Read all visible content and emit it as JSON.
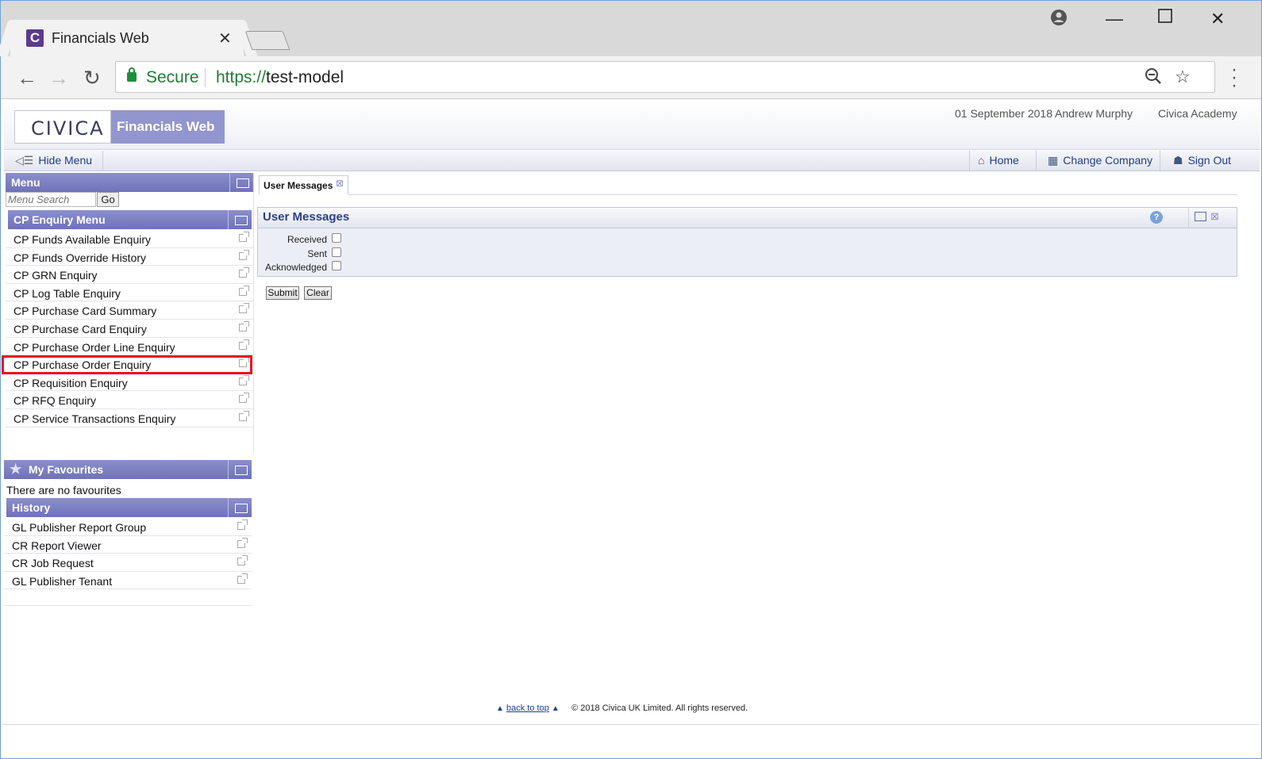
{
  "browser": {
    "tab_title": "Financials Web",
    "tab_favicon": "C",
    "secure_label": "Secure",
    "url_scheme": "https://",
    "url_host": "test-model"
  },
  "header": {
    "logo_text": "CIVICA",
    "product_name": "Financials Web",
    "date": "01 September 2018",
    "user": "Andrew Murphy",
    "company": "Civica Academy"
  },
  "subbar": {
    "hide_menu": "Hide Menu",
    "home": "Home",
    "change_company": "Change Company",
    "sign_out": "Sign Out"
  },
  "menu": {
    "title": "Menu",
    "search_placeholder": "Menu Search",
    "go_label": "Go",
    "section_title": "CP Enquiry Menu",
    "items": [
      "CP Funds Available Enquiry",
      "CP Funds Override History",
      "CP GRN Enquiry",
      "CP Log Table Enquiry",
      "CP Purchase Card Summary",
      "CP Purchase Card Enquiry",
      "CP Purchase Order Line Enquiry",
      "CP Purchase Order Enquiry",
      "CP Requisition Enquiry",
      "CP RFQ Enquiry",
      "CP Service Transactions Enquiry"
    ],
    "highlighted_item": "CP Purchase Order Enquiry"
  },
  "favourites": {
    "title": "My Favourites",
    "empty_text": "There are no favourites"
  },
  "history": {
    "title": "History",
    "items": [
      "GL Publisher Report Group",
      "CR Report Viewer",
      "CR Job Request",
      "GL Publisher Tenant"
    ]
  },
  "content": {
    "tab_label": "User Messages",
    "panel_title": "User Messages",
    "fields": [
      {
        "label": "Received",
        "checked": false
      },
      {
        "label": "Sent",
        "checked": false
      },
      {
        "label": "Acknowledged",
        "checked": false
      }
    ],
    "submit_label": "Submit",
    "clear_label": "Clear"
  },
  "footer": {
    "back_to_top": "back to top",
    "copyright": "© 2018 Civica UK Limited. All rights reserved."
  },
  "colors": {
    "panel_header": "#7b7ec1",
    "product_box": "#9395ce",
    "link": "#1f3d8c",
    "highlight": "#e8111b"
  }
}
